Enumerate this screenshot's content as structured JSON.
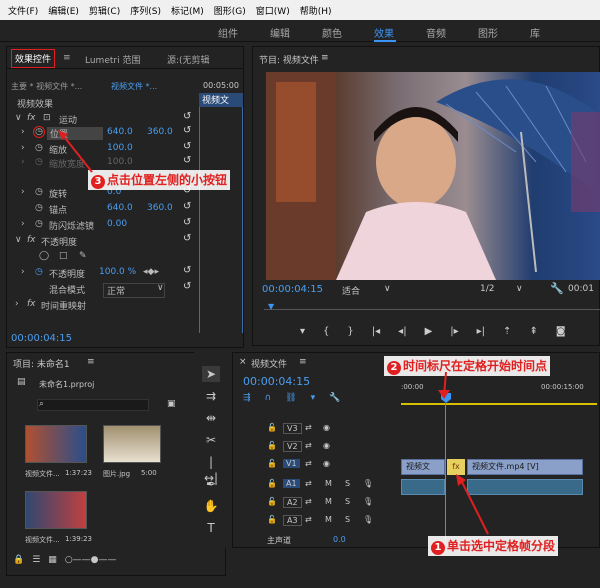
{
  "menu": [
    "文件(F)",
    "编辑(E)",
    "剪辑(C)",
    "序列(S)",
    "标记(M)",
    "图形(G)",
    "窗口(W)",
    "帮助(H)"
  ],
  "workspaces": [
    "组件",
    "编辑",
    "颜色",
    "效果",
    "音频",
    "图形",
    "库"
  ],
  "workspace_active": "效果",
  "fx_panel": {
    "tab_active": "效果控件",
    "tab2": "Lumetri 范围",
    "tab3": "源:(无剪辑",
    "master": "主要 * 视频文件 *...",
    "clip": "视频文件 *...",
    "time": "00:05:00",
    "clip_label": "视频文",
    "section_video": "视频效果",
    "motion": "运动",
    "position": "位置",
    "pos_x": "640.0",
    "pos_y": "360.0",
    "scale": "缩放",
    "scale_val": "100.0",
    "scale_width": "缩放宽度",
    "scale_width_val": "100.0",
    "rotation": "旋转",
    "rotation_val": "0.0",
    "anchor": "锚点",
    "anchor_x": "640.0",
    "anchor_y": "360.0",
    "antiflicker": "防闪烁滤镜",
    "antiflicker_val": "0.00",
    "opacity_section": "不透明度",
    "opacity": "不透明度",
    "opacity_val": "100.0 %",
    "blend": "混合模式",
    "blend_val": "正常",
    "time_remap": "时间重映射",
    "timecode": "00:00:04:15"
  },
  "program": {
    "title": "节目: 视频文件",
    "timecode": "00:00:04:15",
    "fit": "适合",
    "ratio": "1/2",
    "end_tc": "00:01"
  },
  "project": {
    "title": "项目: 未命名1",
    "file": "未命名1.prproj",
    "items": [
      {
        "name": "视频文件...",
        "dur": "1:37:23"
      },
      {
        "name": "图片.jpg",
        "dur": "5:00"
      },
      {
        "name": "视频文件...",
        "dur": "1:39:23"
      }
    ]
  },
  "timeline": {
    "title": "视频文件",
    "timecode": "00:00:04:15",
    "ruler_start": ":00:00",
    "ruler_mid": "00:00:15:00",
    "tracks": [
      "V3",
      "V2",
      "V1",
      "A1",
      "A2",
      "A3"
    ],
    "master": "主声道",
    "master_val": "0.0",
    "clip1": "视频文",
    "clip2": "视频文件.mp4 [V]",
    "fx_badge": "fx"
  },
  "callouts": {
    "c1_num": "1",
    "c1": "单击选中定格帧分段",
    "c2_num": "2",
    "c2": "时间标尺在定格开始时间点",
    "c3_num": "3",
    "c3": "点击位置左侧的小按钮"
  },
  "colors": {
    "accent": "#3b95f5",
    "callout": "#e02020",
    "clip_video": "#8aa0c8",
    "clip_audio": "#3a6a8a"
  }
}
